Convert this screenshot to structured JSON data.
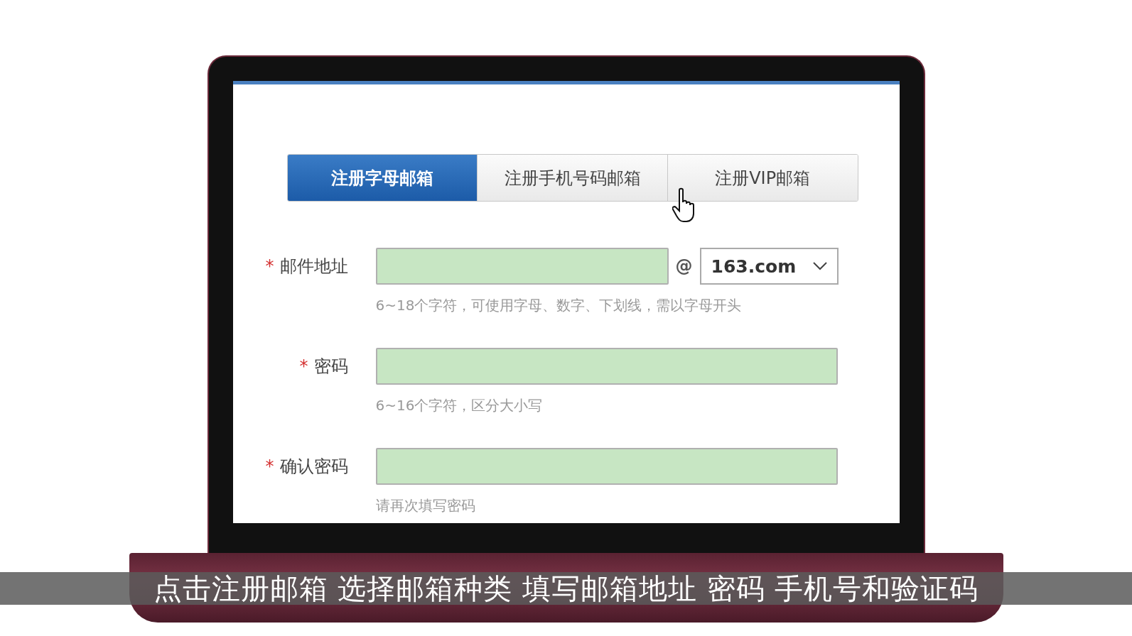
{
  "tabs": [
    {
      "label": "注册字母邮箱",
      "selected": true
    },
    {
      "label": "注册手机号码邮箱",
      "selected": false
    },
    {
      "label": "注册VIP邮箱",
      "selected": false
    }
  ],
  "fields": [
    {
      "kind": "email",
      "marker": "*",
      "label": "邮件地址",
      "at": "@",
      "domain": "163.com",
      "hint": "6~18个字符，可使用字母、数字、下划线，需以字母开头"
    },
    {
      "kind": "plain",
      "marker": "*",
      "label": "密码",
      "hint": "6~16个字符，区分大小写"
    },
    {
      "kind": "plain",
      "marker": "*",
      "label": "确认密码",
      "hint": "请再次填写密码"
    }
  ],
  "caption": "点击注册邮箱 选择邮箱种类 填写邮箱地址 密码 手机号和验证码"
}
